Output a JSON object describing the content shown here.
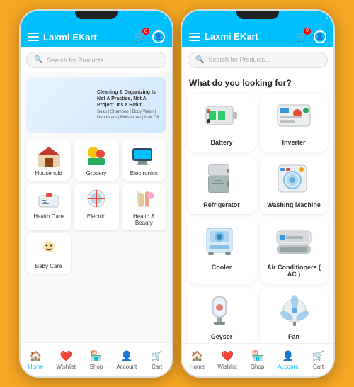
{
  "app": {
    "name": "Laxmi EKart"
  },
  "phone1": {
    "header": {
      "title": "Laxmi EKart"
    },
    "search": {
      "placeholder": "Search for Products..."
    },
    "banner": {
      "title": "Cleaning & Organizing Is Not A Practice, Not A Project. It's a Habit...",
      "subtitle": "Soap | Shampoo | Body Wash | Deodorant | Moisturizer | Hair Oil"
    },
    "categories": [
      {
        "id": "household",
        "label": "Household",
        "icon": "🏠",
        "emoji": "🏡"
      },
      {
        "id": "grocery",
        "label": "Grocery",
        "icon": "🛒",
        "emoji": "🛒"
      },
      {
        "id": "electronics",
        "label": "Electronics",
        "icon": "💻",
        "emoji": "💻"
      },
      {
        "id": "healthcare",
        "label": "Health Care",
        "icon": "💊",
        "emoji": "💊"
      },
      {
        "id": "electric",
        "label": "Electric",
        "icon": "⚡",
        "emoji": "🔌"
      },
      {
        "id": "beauty",
        "label": "Health & Beauty",
        "icon": "💄",
        "emoji": "🌸"
      },
      {
        "id": "baby",
        "label": "Baby Care",
        "icon": "👶",
        "emoji": "👶"
      }
    ],
    "bottomNav": [
      {
        "id": "home",
        "label": "Home",
        "icon": "🏠",
        "active": true
      },
      {
        "id": "wishlist",
        "label": "Wishlist",
        "icon": "❤️",
        "active": false
      },
      {
        "id": "shop",
        "label": "Shop",
        "icon": "🏪",
        "active": false
      },
      {
        "id": "account",
        "label": "Account",
        "icon": "👤",
        "active": false
      },
      {
        "id": "cart",
        "label": "Cart",
        "icon": "🛒",
        "active": false
      }
    ]
  },
  "phone2": {
    "header": {
      "title": "Laxmi EKart"
    },
    "search": {
      "placeholder": "Search for Products..."
    },
    "sectionTitle": "What do you looking for?",
    "products": [
      {
        "id": "battery",
        "name": "Battery",
        "emoji": "🔋"
      },
      {
        "id": "inverter",
        "name": "Inverter",
        "emoji": "⚡"
      },
      {
        "id": "refrigerator",
        "name": "Refrigerator",
        "emoji": "🧊"
      },
      {
        "id": "washing-machine",
        "name": "Washing Machine",
        "emoji": "🫧"
      },
      {
        "id": "cooler",
        "name": "Cooler",
        "emoji": "❄️"
      },
      {
        "id": "ac",
        "name": "Air Conditioners ( AC )",
        "emoji": "🌡️"
      },
      {
        "id": "geyser",
        "name": "Geyser",
        "emoji": "🚿"
      },
      {
        "id": "fan",
        "name": "Fan",
        "emoji": "💨"
      }
    ],
    "bottomNav": [
      {
        "id": "home",
        "label": "Home",
        "icon": "🏠",
        "active": false
      },
      {
        "id": "wishlist",
        "label": "Wishlist",
        "icon": "❤️",
        "active": false
      },
      {
        "id": "shop",
        "label": "Shop",
        "icon": "🏪",
        "active": false
      },
      {
        "id": "account",
        "label": "Account",
        "icon": "👤",
        "active": true
      },
      {
        "id": "cart",
        "label": "Cart",
        "icon": "🛒",
        "active": false
      }
    ]
  },
  "colors": {
    "primary": "#00BFFF",
    "accent": "#F5A623",
    "danger": "#e74c3c",
    "text": "#333333"
  }
}
